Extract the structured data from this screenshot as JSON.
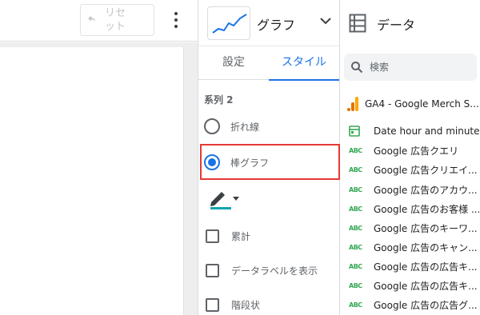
{
  "toolbar": {
    "reset_label": "リセット",
    "undo_icon": "undo-icon",
    "more_icon": "more-vert-icon"
  },
  "chart": {
    "type_label": "グラフ",
    "thumb_icon": "line-chart-icon",
    "dropdown_icon": "chevron-down-icon"
  },
  "tabs": {
    "settings": "設定",
    "style": "スタイル",
    "active": "style"
  },
  "series": {
    "title": "系列 2",
    "options": [
      {
        "label": "折れ線",
        "selected": false
      },
      {
        "label": "棒グラフ",
        "selected": true
      }
    ],
    "color_icon": "pen-color-icon",
    "line_color": "#12a4af",
    "checkboxes": [
      {
        "label": "累計",
        "checked": false
      },
      {
        "label": "データラベルを表示",
        "checked": false
      },
      {
        "label": "階段状",
        "checked": false
      }
    ]
  },
  "data_panel": {
    "title": "データ",
    "search_placeholder": "検索",
    "source": "GA4 - Google Merch S...",
    "fields": [
      {
        "type": "date",
        "name": "Date hour and minute"
      },
      {
        "type": "ABC",
        "name": "Google 広告クエリ"
      },
      {
        "type": "ABC",
        "name": "Google 広告クリエイ..."
      },
      {
        "type": "ABC",
        "name": "Google 広告のアカウ..."
      },
      {
        "type": "ABC",
        "name": "Google 広告のお客様 ..."
      },
      {
        "type": "ABC",
        "name": "Google 広告のキーワ..."
      },
      {
        "type": "ABC",
        "name": "Google 広告のキャン..."
      },
      {
        "type": "ABC",
        "name": "Google 広告の広告キ..."
      },
      {
        "type": "ABC",
        "name": "Google 広告の広告キ..."
      },
      {
        "type": "ABC",
        "name": "Google 広告の広告グ..."
      }
    ]
  },
  "colors": {
    "accent": "#1a73e8",
    "highlight": "#e53935",
    "field_green": "#34a853",
    "ga_orange": "#f9ab00"
  }
}
